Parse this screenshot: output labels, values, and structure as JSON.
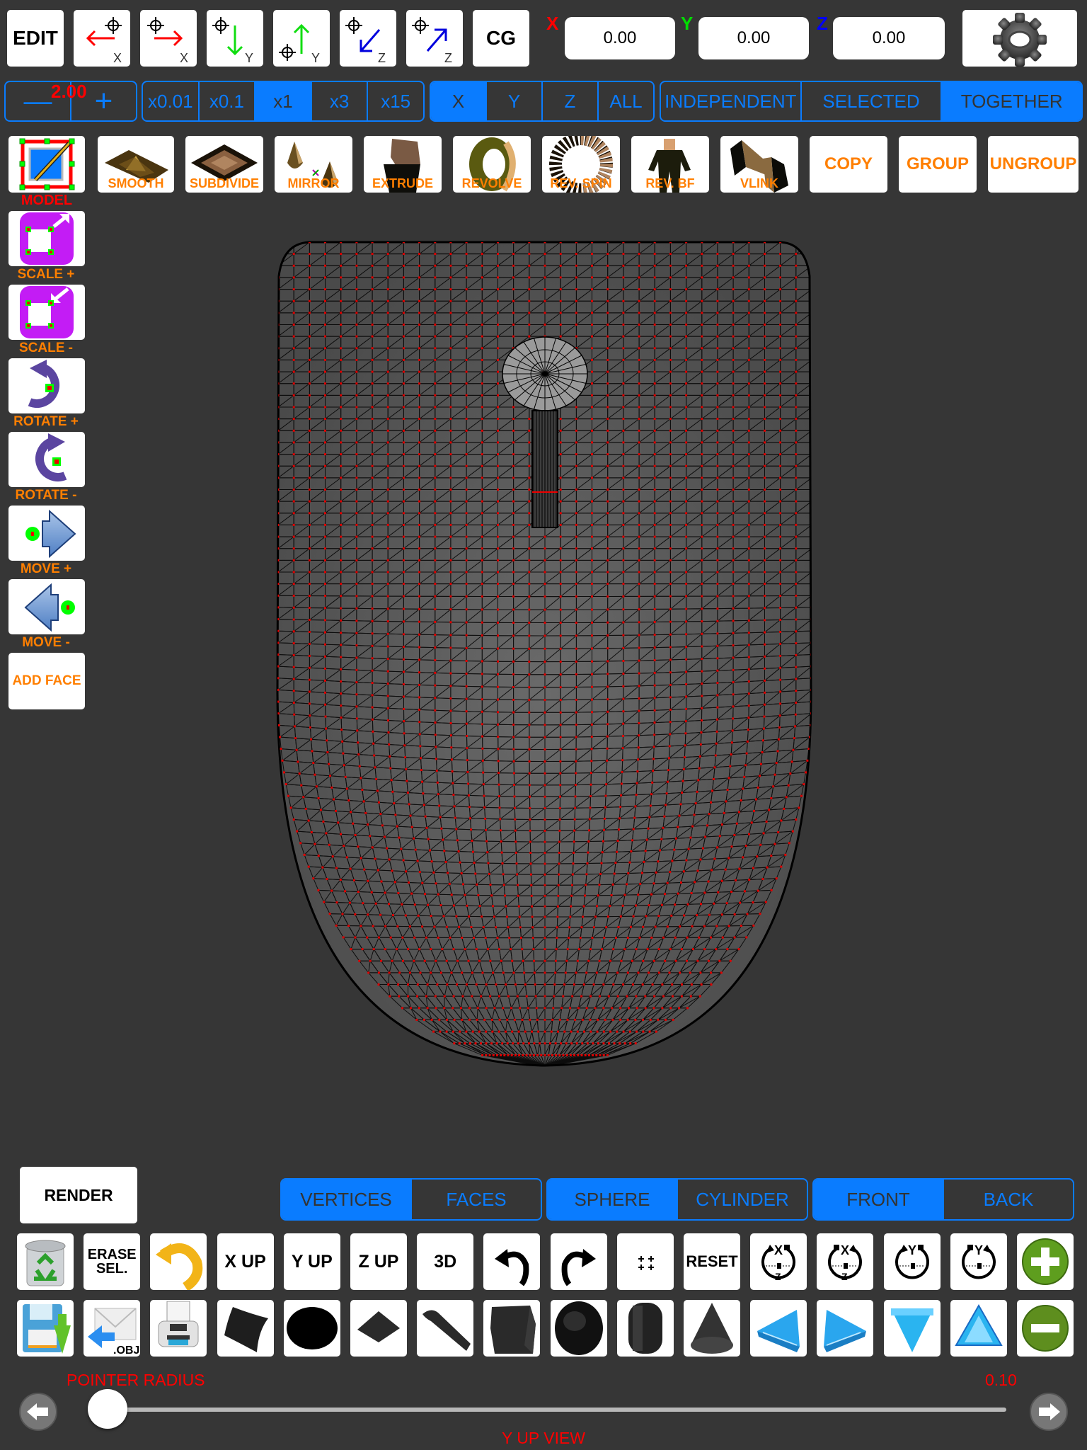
{
  "top_toolbar": {
    "edit_label": "EDIT",
    "move_buttons": [
      {
        "icon": "move-x-negative-icon",
        "axis": "X"
      },
      {
        "icon": "move-x-positive-icon",
        "axis": "X"
      },
      {
        "icon": "move-y-negative-icon",
        "axis": "Y"
      },
      {
        "icon": "move-y-positive-icon",
        "axis": "Y"
      },
      {
        "icon": "move-z-negative-icon",
        "axis": "Z"
      },
      {
        "icon": "move-z-positive-icon",
        "axis": "Z"
      }
    ],
    "cg_label": "CG",
    "coords": {
      "x_label": "X",
      "x_value": "0.00",
      "y_label": "Y",
      "y_value": "0.00",
      "z_label": "Z",
      "z_value": "0.00"
    },
    "settings_icon": "gear-icon"
  },
  "step_control": {
    "value": "2.00",
    "minus": "—",
    "plus": "+"
  },
  "multiplier": {
    "options": [
      "x0.01",
      "x0.1",
      "x1",
      "x3",
      "x15"
    ],
    "selected": "x1"
  },
  "axis_select": {
    "options": [
      "X",
      "Y",
      "Z",
      "ALL"
    ],
    "selected": "X"
  },
  "mode_select": {
    "options": [
      "INDEPENDENT",
      "SELECTED",
      "TOGETHER"
    ],
    "selected": "TOGETHER"
  },
  "tools": [
    {
      "label": "",
      "icon": "model-edit-icon"
    },
    {
      "label": "SMOOTH",
      "icon": "smooth-icon"
    },
    {
      "label": "SUBDIVIDE",
      "icon": "subdivide-icon"
    },
    {
      "label": "MIRROR",
      "icon": "mirror-icon"
    },
    {
      "label": "EXTRUDE",
      "icon": "extrude-icon"
    },
    {
      "label": "REVOLVE",
      "icon": "revolve-icon"
    },
    {
      "label": "REV. SPIN",
      "icon": "rev-spin-icon"
    },
    {
      "label": "REV. BF",
      "icon": "rev-bf-icon"
    },
    {
      "label": "VLINK",
      "icon": "vlink-icon"
    },
    {
      "label": "COPY",
      "icon": ""
    },
    {
      "label": "GROUP",
      "icon": ""
    },
    {
      "label": "UNGROUP",
      "icon": ""
    }
  ],
  "model_label": "MODEL",
  "side_tools": [
    {
      "label": "SCALE +",
      "icon": "scale-up-icon"
    },
    {
      "label": "SCALE -",
      "icon": "scale-down-icon"
    },
    {
      "label": "ROTATE +",
      "icon": "rotate-ccw-icon"
    },
    {
      "label": "ROTATE -",
      "icon": "rotate-cw-icon"
    },
    {
      "label": "MOVE +",
      "icon": "move-right-icon"
    },
    {
      "label": "MOVE -",
      "icon": "move-left-icon"
    }
  ],
  "add_face_label": "ADD FACE",
  "render_label": "RENDER",
  "select_type": {
    "options": [
      "VERTICES",
      "FACES"
    ],
    "selected": "VERTICES"
  },
  "brush_shape": {
    "options": [
      "SPHERE",
      "CYLINDER"
    ],
    "selected": "SPHERE"
  },
  "side_select": {
    "options": [
      "FRONT",
      "BACK"
    ],
    "selected": "FRONT"
  },
  "bottom_row1": [
    {
      "label": "",
      "icon": "trash-recycle-icon"
    },
    {
      "label": "ERASE\nSEL.",
      "icon": ""
    },
    {
      "label": "",
      "icon": "undo-yellow-icon"
    },
    {
      "label": "X UP",
      "icon": ""
    },
    {
      "label": "Y UP",
      "icon": ""
    },
    {
      "label": "Z UP",
      "icon": ""
    },
    {
      "label": "3D",
      "icon": ""
    },
    {
      "label": "",
      "icon": "undo-icon"
    },
    {
      "label": "",
      "icon": "redo-icon"
    },
    {
      "label": "",
      "icon": "grid-points-icon"
    },
    {
      "label": "RESET",
      "icon": ""
    },
    {
      "label": "",
      "icon": "rotate-x-ccw-icon"
    },
    {
      "label": "",
      "icon": "rotate-x-cw-icon"
    },
    {
      "label": "",
      "icon": "rotate-y-ccw-icon"
    },
    {
      "label": "",
      "icon": "rotate-y-cw-icon"
    },
    {
      "label": "",
      "icon": "zoom-in-plus-icon"
    }
  ],
  "bottom_row2": [
    {
      "icon": "save-icon"
    },
    {
      "icon": "import-obj-icon",
      "label": ".OBJ"
    },
    {
      "icon": "print-icon"
    },
    {
      "icon": "curved-plane-icon"
    },
    {
      "icon": "disc-icon"
    },
    {
      "icon": "plane-icon"
    },
    {
      "icon": "bent-strip-icon"
    },
    {
      "icon": "cube-icon"
    },
    {
      "icon": "sphere-icon"
    },
    {
      "icon": "cylinder-icon"
    },
    {
      "icon": "cone-icon"
    },
    {
      "icon": "nudge-left-icon"
    },
    {
      "icon": "nudge-right-icon"
    },
    {
      "icon": "nudge-down-icon"
    },
    {
      "icon": "nudge-up-icon"
    },
    {
      "icon": "zoom-out-minus-icon"
    }
  ],
  "pointer_radius": {
    "label": "POINTER RADIUS",
    "value": "0.10",
    "slider_fraction": 0.0
  },
  "view_label": "Y UP VIEW",
  "colors": {
    "accent": "#0a7cff",
    "label_orange": "#ff7f00",
    "alert_red": "#ff0000",
    "background": "#363636",
    "mesh_fill": "#5a5a5a",
    "vertex_red": "#e00000"
  }
}
